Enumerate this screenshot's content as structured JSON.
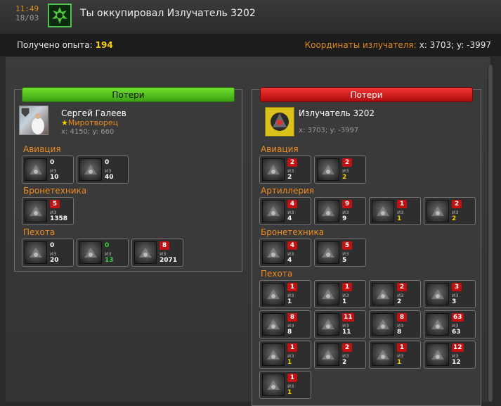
{
  "header": {
    "time": "11:49",
    "date": "18/03",
    "title": "Ты оккупировал Излучатель 3202"
  },
  "info": {
    "exp_label": "Получено опыта:",
    "exp_value": "194",
    "coord_label": "Координаты излучателя:",
    "coord_value": "x: 3703; y: -3997"
  },
  "left": {
    "header": "Потери",
    "name": "Сергей Галеев",
    "rank": "Миротворец",
    "coords": "x: 4150; y: 660",
    "categories": [
      {
        "label": "Авиация",
        "units": [
          {
            "lost": "0",
            "of": "из",
            "total": "10",
            "badge": "plain",
            "tc": "white"
          },
          {
            "lost": "0",
            "of": "из",
            "total": "40",
            "badge": "plain",
            "tc": "white"
          }
        ]
      },
      {
        "label": "Бронетехника",
        "units": [
          {
            "lost": "5",
            "of": "из",
            "total": "1358",
            "badge": "red",
            "tc": "white"
          }
        ]
      },
      {
        "label": "Пехота",
        "units": [
          {
            "lost": "0",
            "of": "из",
            "total": "20",
            "badge": "plain",
            "tc": "white"
          },
          {
            "lost": "0",
            "of": "из",
            "total": "13",
            "badge": "plain",
            "tc": "green",
            "lc": "green"
          },
          {
            "lost": "8",
            "of": "из",
            "total": "2071",
            "badge": "red",
            "tc": "white"
          }
        ]
      }
    ]
  },
  "right": {
    "header": "Потери",
    "name": "Излучатель 3202",
    "coords": "x: 3703; y: -3997",
    "categories": [
      {
        "label": "Авиация",
        "units": [
          {
            "lost": "2",
            "of": "из",
            "total": "2",
            "badge": "red",
            "tc": "white"
          },
          {
            "lost": "2",
            "of": "из",
            "total": "2",
            "badge": "red",
            "tc": "yellow"
          }
        ]
      },
      {
        "label": "Артиллерия",
        "units": [
          {
            "lost": "4",
            "of": "из",
            "total": "4",
            "badge": "red",
            "tc": "white"
          },
          {
            "lost": "9",
            "of": "из",
            "total": "9",
            "badge": "red",
            "tc": "white"
          },
          {
            "lost": "1",
            "of": "из",
            "total": "1",
            "badge": "red",
            "tc": "yellow"
          },
          {
            "lost": "2",
            "of": "из",
            "total": "2",
            "badge": "red",
            "tc": "yellow"
          }
        ]
      },
      {
        "label": "Бронетехника",
        "units": [
          {
            "lost": "4",
            "of": "из",
            "total": "4",
            "badge": "red",
            "tc": "white"
          },
          {
            "lost": "5",
            "of": "из",
            "total": "5",
            "badge": "red",
            "tc": "white"
          }
        ]
      },
      {
        "label": "Пехота",
        "units": [
          {
            "lost": "1",
            "of": "из",
            "total": "1",
            "badge": "red",
            "tc": "white"
          },
          {
            "lost": "1",
            "of": "из",
            "total": "1",
            "badge": "red",
            "tc": "white"
          },
          {
            "lost": "2",
            "of": "из",
            "total": "2",
            "badge": "red",
            "tc": "white"
          },
          {
            "lost": "3",
            "of": "из",
            "total": "3",
            "badge": "red",
            "tc": "white"
          },
          {
            "lost": "8",
            "of": "из",
            "total": "8",
            "badge": "red",
            "tc": "white"
          },
          {
            "lost": "11",
            "of": "из",
            "total": "11",
            "badge": "red",
            "tc": "white"
          },
          {
            "lost": "8",
            "of": "из",
            "total": "8",
            "badge": "red",
            "tc": "white"
          },
          {
            "lost": "63",
            "of": "из",
            "total": "63",
            "badge": "red",
            "tc": "white"
          },
          {
            "lost": "1",
            "of": "из",
            "total": "1",
            "badge": "red",
            "tc": "yellow"
          },
          {
            "lost": "2",
            "of": "из",
            "total": "2",
            "badge": "red",
            "tc": "white"
          },
          {
            "lost": "1",
            "of": "из",
            "total": "1",
            "badge": "red",
            "tc": "yellow"
          },
          {
            "lost": "12",
            "of": "из",
            "total": "12",
            "badge": "red",
            "tc": "white"
          },
          {
            "lost": "1",
            "of": "из",
            "total": "1",
            "badge": "red",
            "tc": "yellow"
          }
        ]
      }
    ]
  },
  "colors": {
    "accent_orange": "#f08c1e",
    "exp_yellow": "#f4d000",
    "header_green": "#4fc24b",
    "header_red": "#d01818"
  }
}
